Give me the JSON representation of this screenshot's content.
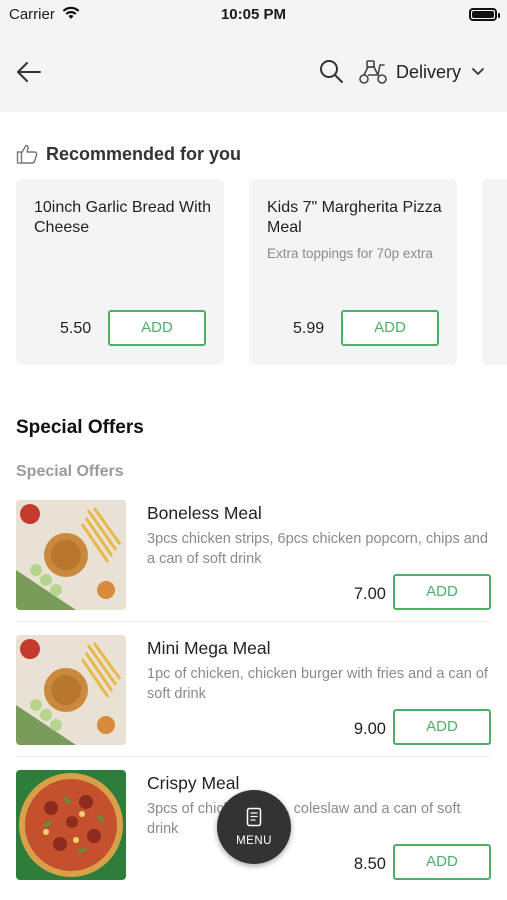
{
  "status_bar": {
    "carrier": "Carrier",
    "time": "10:05 PM"
  },
  "header": {
    "back_icon": "arrow-left-icon",
    "search_icon": "search-icon",
    "delivery_icon": "scooter-icon",
    "delivery_label": "Delivery",
    "chevron_icon": "chevron-down-icon"
  },
  "recommended": {
    "icon": "thumbs-up-icon",
    "title": "Recommended for you",
    "items": [
      {
        "name": "10inch Garlic Bread With Cheese",
        "description": "",
        "price": "5.50",
        "add_label": "ADD"
      },
      {
        "name": "Kids 7\" Margherita Pizza Meal",
        "description": "Extra toppings for 70p extra",
        "price": "5.99",
        "add_label": "ADD"
      }
    ]
  },
  "special_offers": {
    "title": "Special Offers",
    "category": "Special Offers",
    "items": [
      {
        "name": "Boneless Meal",
        "description": "3pcs chicken strips, 6pcs chicken popcorn, chips and a can of soft drink",
        "price": "7.00",
        "add_label": "ADD"
      },
      {
        "name": "Mini Mega Meal",
        "description": "1pc of chicken, chicken burger with fries and a can of soft drink",
        "price": "9.00",
        "add_label": "ADD"
      },
      {
        "name": "Crispy Meal",
        "description": "3pcs of chicken strips, coleslaw and a can of soft drink",
        "price": "8.50",
        "add_label": "ADD"
      }
    ]
  },
  "fab": {
    "icon": "menu-book-icon",
    "label": "MENU"
  },
  "colors": {
    "accent_green": "#4caf68",
    "header_bg": "#f4f4f4",
    "fab_bg": "#333333"
  }
}
